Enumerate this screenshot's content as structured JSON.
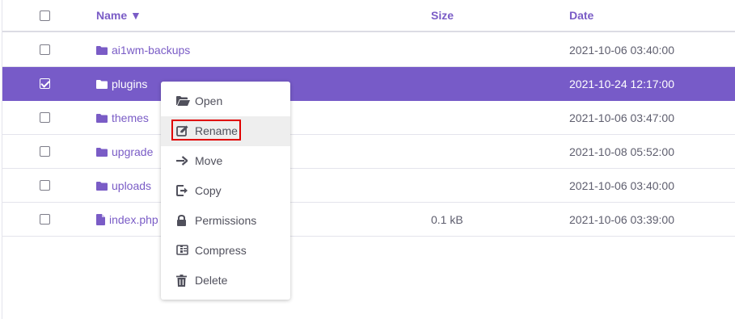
{
  "header": {
    "name_label": "Name ▼",
    "size_label": "Size",
    "date_label": "Date"
  },
  "rows": [
    {
      "name": "ai1wm-backups",
      "type": "folder",
      "size": "",
      "date": "2021-10-06 03:40:00",
      "selected": false
    },
    {
      "name": "plugins",
      "type": "folder",
      "size": "",
      "date": "2021-10-24 12:17:00",
      "selected": true
    },
    {
      "name": "themes",
      "type": "folder",
      "size": "",
      "date": "2021-10-06 03:47:00",
      "selected": false
    },
    {
      "name": "upgrade",
      "type": "folder",
      "size": "",
      "date": "2021-10-08 05:52:00",
      "selected": false
    },
    {
      "name": "uploads",
      "type": "folder",
      "size": "",
      "date": "2021-10-06 03:40:00",
      "selected": false
    },
    {
      "name": "index.php",
      "type": "file",
      "size": "0.1 kB",
      "date": "2021-10-06 03:39:00",
      "selected": false
    }
  ],
  "context_menu": {
    "items": [
      {
        "label": "Open",
        "icon": "folder-open-icon"
      },
      {
        "label": "Rename",
        "icon": "edit-icon"
      },
      {
        "label": "Move",
        "icon": "arrow-right-icon"
      },
      {
        "label": "Copy",
        "icon": "copy-icon"
      },
      {
        "label": "Permissions",
        "icon": "lock-icon"
      },
      {
        "label": "Compress",
        "icon": "archive-icon"
      },
      {
        "label": "Delete",
        "icon": "trash-icon"
      }
    ]
  },
  "colors": {
    "accent": "#775bc8",
    "link": "#7a5cc6",
    "highlight_border": "#e00000"
  }
}
